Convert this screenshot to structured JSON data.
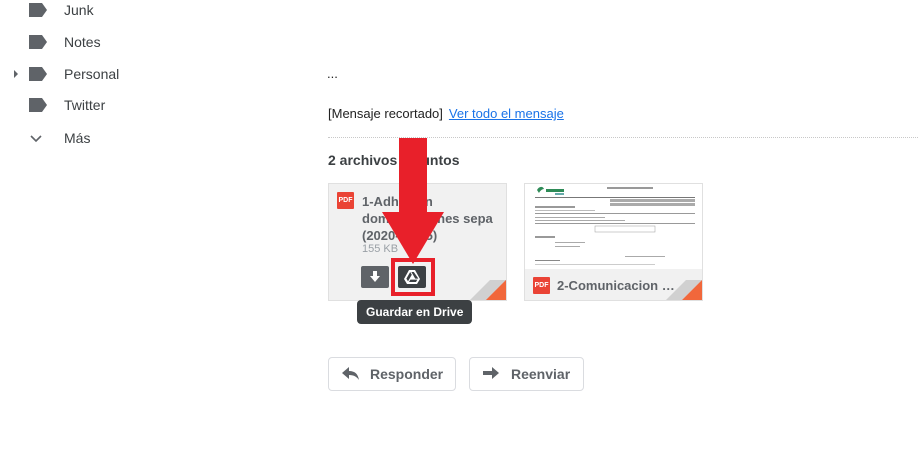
{
  "sidebar": {
    "items": [
      {
        "label": "Junk",
        "icon": "label-icon"
      },
      {
        "label": "Notes",
        "icon": "label-icon"
      },
      {
        "label": "Personal",
        "icon": "label-icon",
        "expandable": true
      },
      {
        "label": "Twitter",
        "icon": "label-icon"
      },
      {
        "label": "Más",
        "icon": "chevron-down-icon"
      }
    ]
  },
  "message": {
    "ellipsis": "...",
    "clipped_text": "[Mensaje recortado]",
    "view_full_link": "Ver todo el mensaje"
  },
  "attachments": {
    "title": "2 archivos adjuntos",
    "items": [
      {
        "type_badge": "PDF",
        "name": "1-Adhesion domiciliaciones sepa (2020-06-05)",
        "size": "155 KB"
      },
      {
        "type_badge": "PDF",
        "name": "2-Comunicacion de..."
      }
    ],
    "download_icon": "download-icon",
    "drive_icon": "google-drive-icon",
    "tooltip": "Guardar en Drive"
  },
  "actions": {
    "reply_label": "Responder",
    "forward_label": "Reenviar"
  },
  "colors": {
    "accent_red": "#e8202a",
    "link_blue": "#1a73e8",
    "pdf_red": "#ea4335"
  }
}
